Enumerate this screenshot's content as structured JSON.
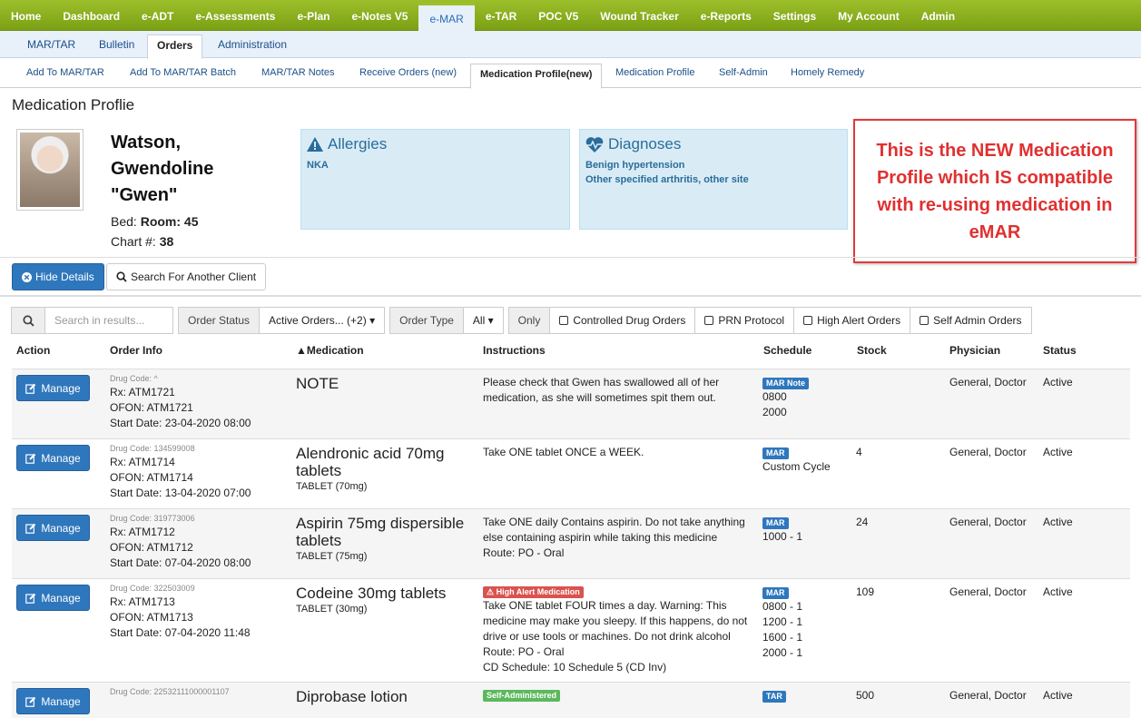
{
  "topnav": [
    "Home",
    "Dashboard",
    "e-ADT",
    "e-Assessments",
    "e-Plan",
    "e-Notes V5",
    "e-MAR",
    "e-TAR",
    "POC V5",
    "Wound Tracker",
    "e-Reports",
    "Settings",
    "My Account",
    "Admin"
  ],
  "subnav": [
    "MAR/TAR",
    "Bulletin",
    "Orders",
    "Administration"
  ],
  "tabs": [
    "Add To MAR/TAR",
    "Add To MAR/TAR Batch",
    "MAR/TAR Notes",
    "Receive Orders (new)",
    "Medication Profile(new)",
    "Medication Profile",
    "Self-Admin",
    "Homely Remedy"
  ],
  "page_title": "Medication Proflie",
  "patient": {
    "name_line1": "Watson,",
    "name_line2": "Gwendoline",
    "name_line3": "\"Gwen\"",
    "bed_label": "Bed:",
    "room": "Room: 45",
    "chart_label": "Chart #:",
    "chart": "38"
  },
  "allergies": {
    "title": "Allergies",
    "value": "NKA"
  },
  "diagnoses": {
    "title": "Diagnoses",
    "items": [
      "Benign hypertension",
      "Other specified arthritis, other site"
    ]
  },
  "callout": [
    "This is the NEW Medication",
    "Profile which IS compatible",
    "with re-using medication in",
    "eMAR"
  ],
  "buttons": {
    "hide_details": "Hide Details",
    "search_client": "Search For Another Client"
  },
  "filters": {
    "search_placeholder": "Search in results...",
    "order_status_label": "Order Status",
    "order_status_value": "Active Orders... (+2)",
    "order_type_label": "Order Type",
    "order_type_value": "All",
    "only": "Only",
    "controlled": "Controlled Drug Orders",
    "prn": "PRN Protocol",
    "high_alert": "High Alert Orders",
    "self_admin": "Self Admin Orders"
  },
  "headers": {
    "action": "Action",
    "order_info": "Order Info",
    "medication": "Medication",
    "instructions": "Instructions",
    "schedule": "Schedule",
    "stock": "Stock",
    "physician": "Physician",
    "status": "Status"
  },
  "manage_label": "Manage",
  "rows": [
    {
      "drug_code": "Drug Code: ^",
      "rx": "Rx: ATM1721",
      "ofon": "OFON: ATM1721",
      "start": "Start Date: 23-04-2020 08:00",
      "med": "NOTE",
      "med_sub": "",
      "tag": "",
      "instr": [
        "Please check that Gwen has swallowed all of her",
        "medication, as she will sometimes spit them out."
      ],
      "sched_badge": "MAR Note",
      "sched": [
        "0800",
        "2000"
      ],
      "stock": "",
      "physician": "General, Doctor",
      "status": "Active"
    },
    {
      "drug_code": "Drug Code: 134599008",
      "rx": "Rx: ATM1714",
      "ofon": "OFON: ATM1714",
      "start": "Start Date: 13-04-2020 07:00",
      "med": "Alendronic acid 70mg tablets",
      "med_sub": "TABLET (70mg)",
      "tag": "",
      "instr": [
        "Take ONE tablet ONCE a WEEK."
      ],
      "sched_badge": "MAR",
      "sched": [
        "Custom Cycle"
      ],
      "stock": "4",
      "physician": "General, Doctor",
      "status": "Active"
    },
    {
      "drug_code": "Drug Code: 319773006",
      "rx": "Rx: ATM1712",
      "ofon": "OFON: ATM1712",
      "start": "Start Date: 07-04-2020 08:00",
      "med": "Aspirin 75mg dispersible tablets",
      "med_sub": "TABLET (75mg)",
      "tag": "",
      "instr": [
        "Take ONE daily Contains aspirin. Do not take anything",
        "else containing aspirin while taking this medicine",
        "Route: PO - Oral"
      ],
      "sched_badge": "MAR",
      "sched": [
        "1000 - 1"
      ],
      "stock": "24",
      "physician": "General, Doctor",
      "status": "Active"
    },
    {
      "drug_code": "Drug Code: 322503009",
      "rx": "Rx: ATM1713",
      "ofon": "OFON: ATM1713",
      "start": "Start Date: 07-04-2020 11:48",
      "med": "Codeine 30mg tablets",
      "med_sub": "TABLET (30mg)",
      "tag": "High Alert Medication",
      "instr": [
        "Take ONE tablet FOUR times a day. Warning: This",
        "medicine may make you sleepy. If this happens, do not",
        "drive or use tools or machines. Do not drink alcohol",
        "Route: PO - Oral",
        "CD Schedule: 10 Schedule 5 (CD Inv)"
      ],
      "sched_badge": "MAR",
      "sched": [
        "0800 - 1",
        "1200 - 1",
        "1600 - 1",
        "2000 - 1"
      ],
      "stock": "109",
      "physician": "General, Doctor",
      "status": "Active"
    },
    {
      "drug_code": "Drug Code: 22532111000001107",
      "rx": "",
      "ofon": "",
      "start": "",
      "med": "Diprobase lotion",
      "med_sub": "",
      "tag": "Self-Administered",
      "instr": [],
      "sched_badge": "TAR",
      "sched": [],
      "stock": "500",
      "physician": "General, Doctor",
      "status": "Active"
    }
  ]
}
